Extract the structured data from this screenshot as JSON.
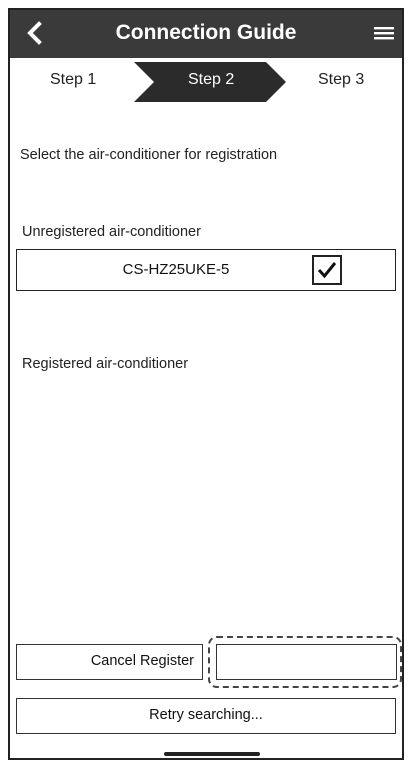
{
  "header": {
    "title": "Connection Guide",
    "back_icon": "chevron-left-icon",
    "menu_icon": "hamburger-menu-icon"
  },
  "steps": [
    {
      "label": "Step 1",
      "active": false
    },
    {
      "label": "Step 2",
      "active": true
    },
    {
      "label": "Step 3",
      "active": false
    }
  ],
  "instruction": "Select the air-conditioner for registration",
  "unregistered": {
    "heading": "Unregistered air-conditioner",
    "items": [
      {
        "name": "CS-HZ25UKE-5",
        "checked": true
      }
    ]
  },
  "registered": {
    "heading": "Registered air-conditioner"
  },
  "buttons": {
    "cancel_register": "Cancel Register",
    "empty_button": "",
    "retry": "Retry searching..."
  },
  "colors": {
    "header_bg": "#3a3a3a",
    "active_step_bg": "#2b2b2b"
  }
}
